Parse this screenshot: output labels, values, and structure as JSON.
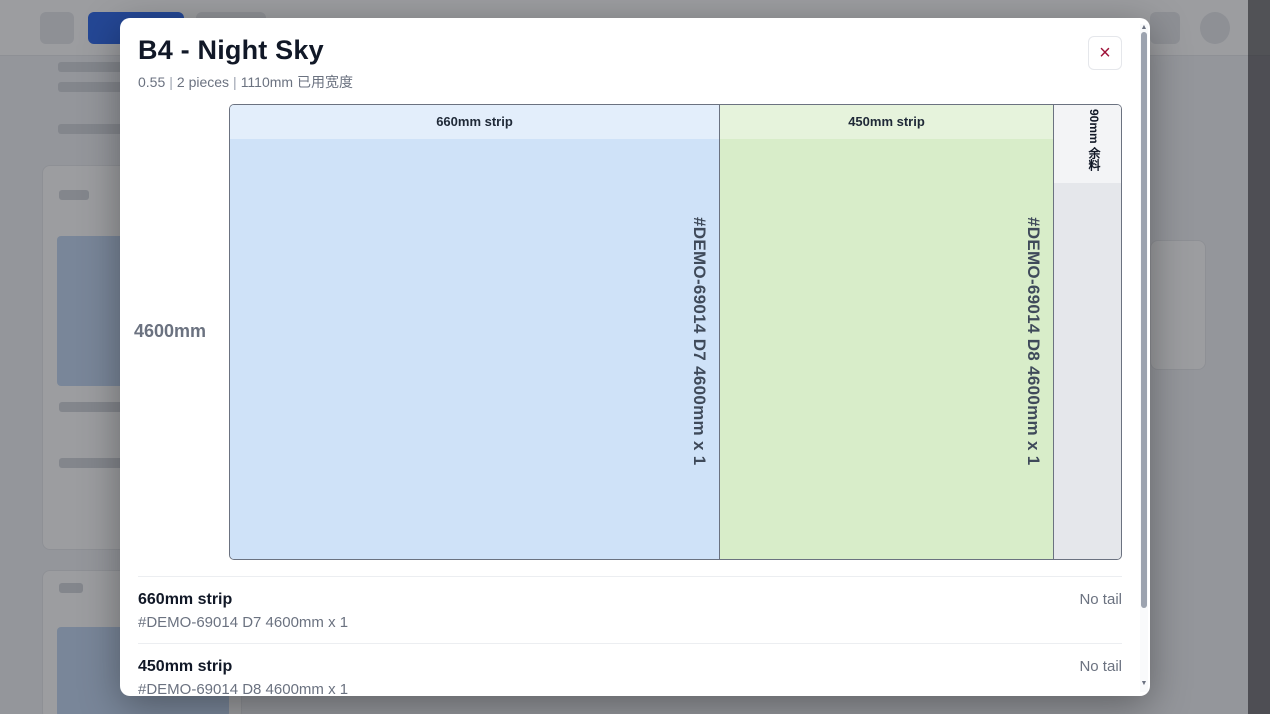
{
  "modal": {
    "title": "B4 - Night Sky",
    "subtitle": {
      "thickness": "0.55",
      "pieces": "2 pieces",
      "used_width": "1110mm 已用宽度"
    },
    "close_label": "×"
  },
  "layout": {
    "length_label": "4600mm",
    "strips": [
      {
        "label": "660mm strip",
        "piece": "#DEMO-69014  D7  4600mm x 1"
      },
      {
        "label": "450mm strip",
        "piece": "#DEMO-69014  D8  4600mm x 1"
      }
    ],
    "tail_label": "90mm 余料"
  },
  "list": [
    {
      "title": "660mm strip",
      "detail": "#DEMO-69014 D7 4600mm x 1",
      "status": "No tail"
    },
    {
      "title": "450mm strip",
      "detail": "#DEMO-69014 D8 4600mm x 1",
      "status": "No tail"
    }
  ],
  "colors": {
    "strip_660": "#cfe2f8",
    "strip_450": "#d8edc9",
    "tail": "#e5e7eb",
    "close_icon": "#9f1239"
  },
  "icons": {
    "close": "close-icon",
    "scroll_up": "arrow-up-icon",
    "scroll_down": "arrow-down-icon"
  }
}
